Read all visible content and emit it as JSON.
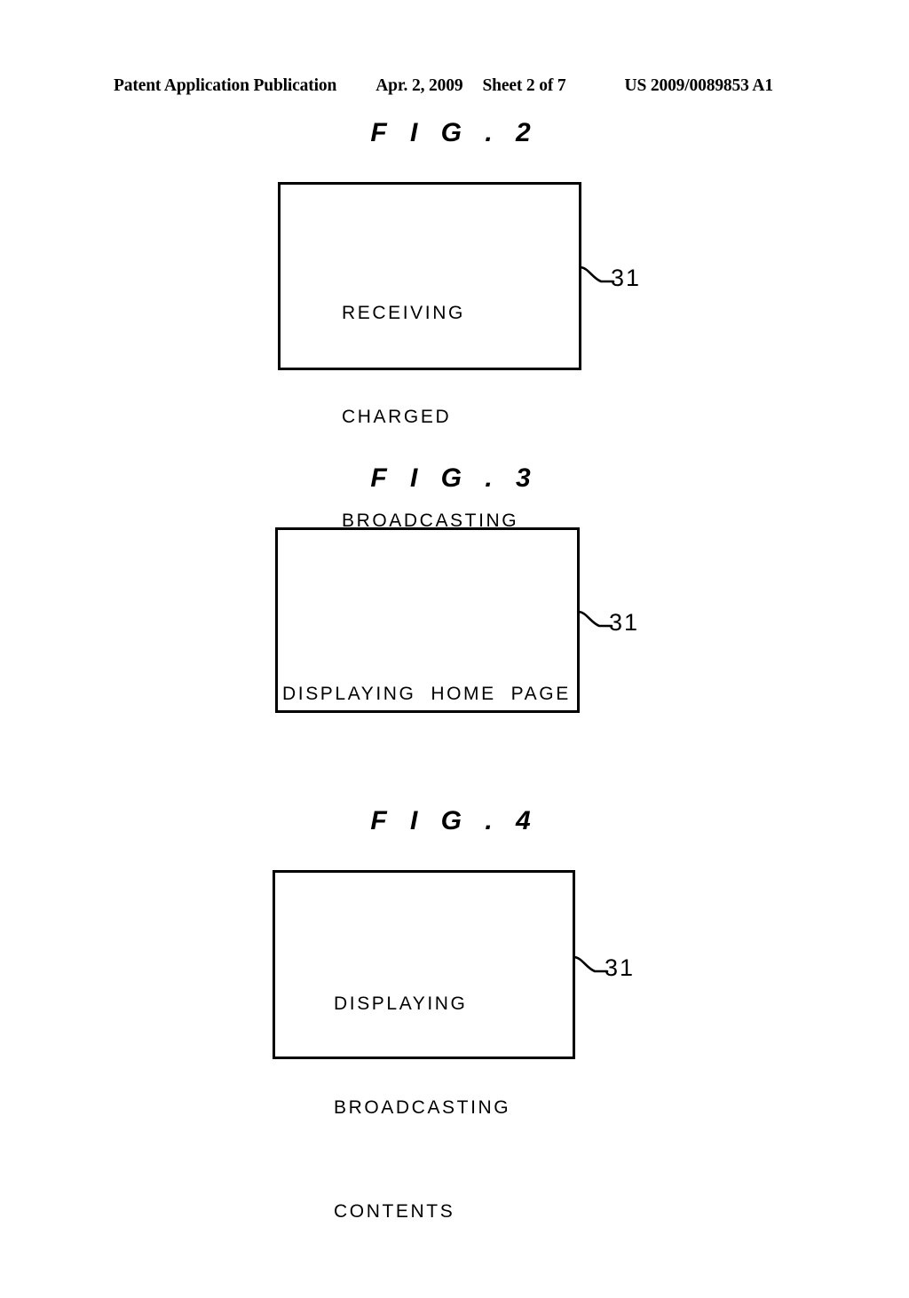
{
  "header": {
    "publication": "Patent Application Publication",
    "date": "Apr. 2, 2009",
    "sheet": "Sheet 2 of 7",
    "document_number": "US 2009/0089853 A1"
  },
  "figures": [
    {
      "caption": "F I G . 2",
      "reference_numeral": "31",
      "lines": [
        "RECEIVING",
        "CHARGED",
        "BROADCASTING"
      ],
      "line1": "RECEIVING",
      "line2": "CHARGED",
      "line3": "BROADCASTING"
    },
    {
      "caption": "F I G . 3",
      "reference_numeral": "31",
      "lines": [
        "DISPLAYING  HOME  PAGE"
      ],
      "line1": "DISPLAYING  HOME  PAGE"
    },
    {
      "caption": "F I G . 4",
      "reference_numeral": "31",
      "lines": [
        "DISPLAYING",
        "BROADCASTING",
        "CONTENTS"
      ],
      "line1": "DISPLAYING",
      "line2": "BROADCASTING",
      "line3": "CONTENTS"
    }
  ],
  "colors": {
    "ink": "#000000",
    "page": "#ffffff"
  }
}
